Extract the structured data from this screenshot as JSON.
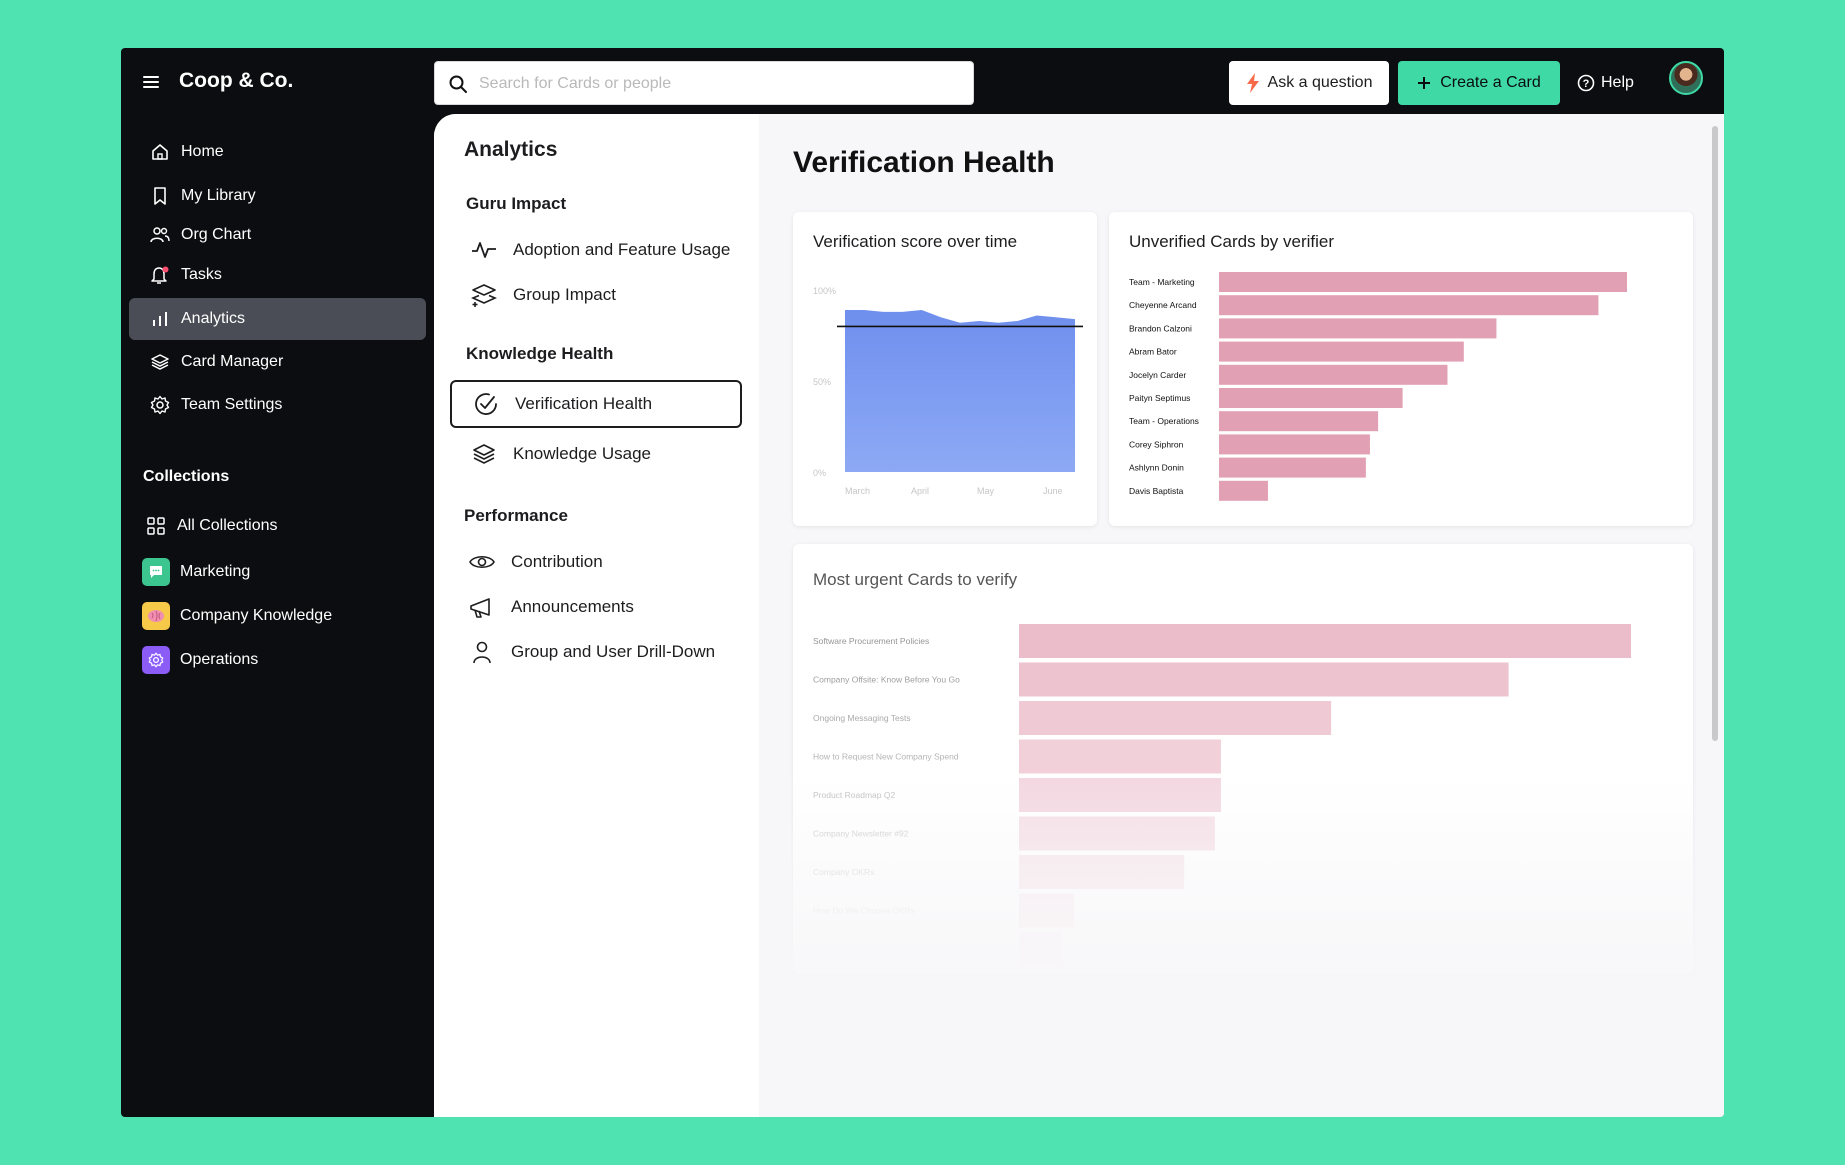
{
  "app": {
    "brand": "Coop & Co."
  },
  "search": {
    "placeholder": "Search for Cards or people"
  },
  "toolbar": {
    "ask_label": "Ask a question",
    "create_label": "Create a Card",
    "help_label": "Help"
  },
  "sidebar": {
    "items": [
      {
        "label": "Home",
        "icon": "home-icon"
      },
      {
        "label": "My Library",
        "icon": "bookmark-icon"
      },
      {
        "label": "Org Chart",
        "icon": "people-icon"
      },
      {
        "label": "Tasks",
        "icon": "bell-icon"
      },
      {
        "label": "Analytics",
        "icon": "bar-chart-icon",
        "active": true
      },
      {
        "label": "Card Manager",
        "icon": "layers-icon"
      },
      {
        "label": "Team Settings",
        "icon": "gear-icon"
      }
    ],
    "collections_heading": "Collections",
    "collections": [
      {
        "label": "All Collections",
        "icon": "grid-icon"
      },
      {
        "label": "Marketing",
        "icon": "chat-icon",
        "color": "#3cc58f"
      },
      {
        "label": "Company Knowledge",
        "icon": "brain-icon",
        "color": "#f7c948"
      },
      {
        "label": "Operations",
        "icon": "gear-icon",
        "color": "#8b5cf6"
      }
    ]
  },
  "subnav": {
    "title": "Analytics",
    "sections": [
      {
        "heading": "Guru Impact",
        "items": [
          {
            "label": "Adoption and Feature Usage",
            "icon": "pulse-icon"
          },
          {
            "label": "Group Impact",
            "icon": "stack-plus-icon"
          }
        ]
      },
      {
        "heading": "Knowledge Health",
        "items": [
          {
            "label": "Verification Health",
            "icon": "check-circle-icon",
            "selected": true
          },
          {
            "label": "Knowledge Usage",
            "icon": "layers-icon"
          }
        ]
      },
      {
        "heading": "Performance",
        "items": [
          {
            "label": "Contribution",
            "icon": "eye-icon"
          },
          {
            "label": "Announcements",
            "icon": "megaphone-icon"
          },
          {
            "label": "Group and User Drill-Down",
            "icon": "person-icon"
          }
        ]
      }
    ]
  },
  "main": {
    "title": "Verification Health"
  },
  "colors": {
    "accent": "#3ed9a4",
    "area": "#7b9bf0",
    "bar": "#e2a0b4"
  },
  "chart_data": [
    {
      "type": "area",
      "title": "Verification score over time",
      "yticks": [
        "100%",
        "50%",
        "0%"
      ],
      "ylim": [
        0,
        100
      ],
      "x": [
        "March",
        "April",
        "May",
        "June"
      ],
      "series": [
        {
          "values": [
            89,
            89,
            88,
            88,
            89,
            85,
            82,
            83,
            82,
            83,
            86,
            85,
            84
          ]
        }
      ],
      "target": 80,
      "grid": false
    },
    {
      "type": "bar",
      "orientation": "horizontal",
      "title": "Unverified Cards by verifier",
      "categories": [
        "Team - Marketing",
        "Cheyenne Arcand",
        "Brandon Calzoni",
        "Abram Bator",
        "Jocelyn Carder",
        "Paityn Septimus",
        "Team - Operations",
        "Corey Siphron",
        "Ashlynn Donin",
        "Davis Baptista"
      ],
      "values": [
        100,
        93,
        68,
        60,
        56,
        45,
        39,
        37,
        36,
        12
      ]
    },
    {
      "type": "bar",
      "orientation": "horizontal",
      "title": "Most urgent Cards to verify",
      "categories": [
        "Software Procurement Policies",
        "Company Offsite: Know Before You Go",
        "Ongoing Messaging Tests",
        "How to Request New Company Spend",
        "Product Roadmap Q2",
        "Company Newsletter #92",
        "Company OKRs",
        "How Do We Choose OKRs"
      ],
      "values": [
        100,
        80,
        51,
        33,
        33,
        32,
        27,
        9,
        7
      ]
    }
  ]
}
